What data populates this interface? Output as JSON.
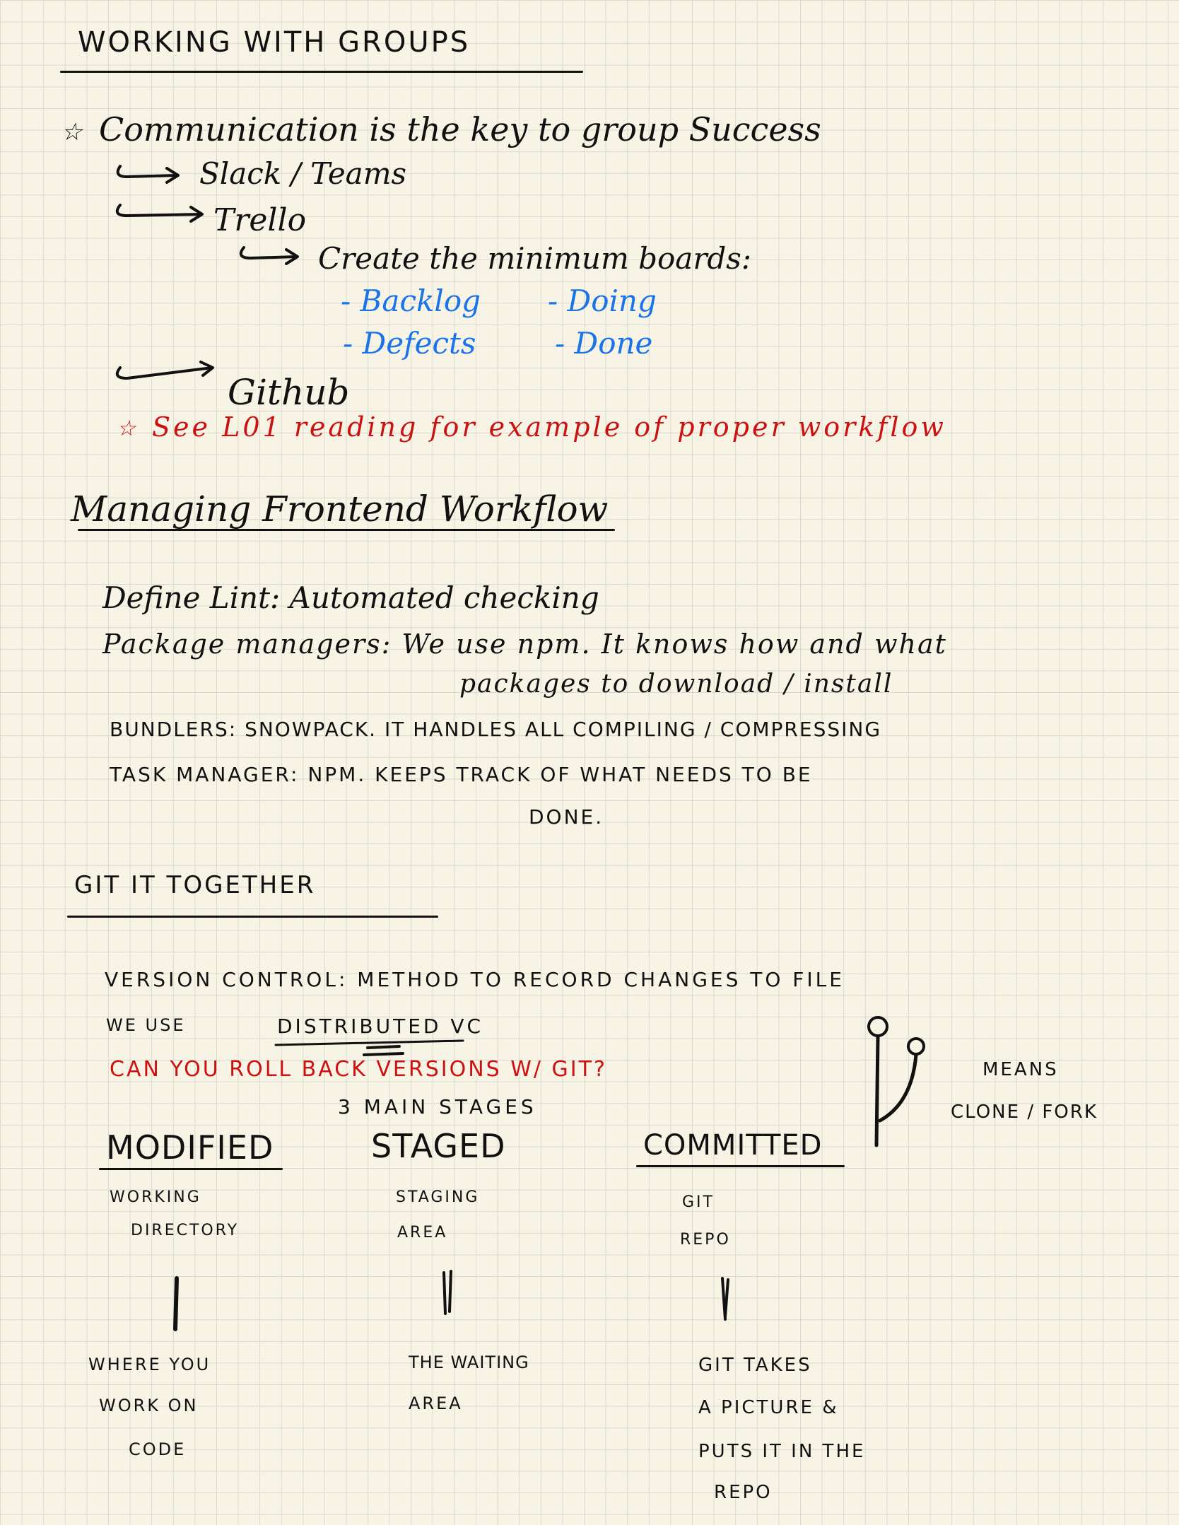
{
  "sections": {
    "groups": {
      "title": "WORKING WITH GROUPS",
      "bullet_star": "☆",
      "bullet": "Communication is the key to group Success",
      "items": [
        "Slack / Teams",
        "Trello",
        "Create the minimum boards:",
        "Github"
      ],
      "boards": [
        "- Backlog",
        "- Doing",
        "- Defects",
        "- Done"
      ],
      "note_star": "☆",
      "note": "See L01 reading for example of proper workflow"
    },
    "frontend": {
      "title": "Managing Frontend Workflow",
      "lint": "Define Lint: Automated checking",
      "pkg_line1": "Package managers: We use npm. It knows how and what",
      "pkg_line2": "packages to download / install",
      "bundlers": "BUNDLERS: SNOWPACK. IT HANDLES ALL COMPILING / COMPRESSING",
      "task_line1": "TASK MANAGER: NPM. KEEPS TRACK OF WHAT NEEDS TO BE",
      "task_line2": "DONE."
    },
    "git": {
      "title": "GIT IT TOGETHER",
      "version_control": "VERSION CONTROL: METHOD TO RECORD CHANGES TO FILE",
      "we_use_prefix": "WE USE",
      "we_use_value": "DISTRIBUTED VC",
      "question": "CAN YOU ROLL BACK VERSIONS W/ GIT?",
      "stages_intro": "3 MAIN STAGES",
      "means_label": "MEANS",
      "means_value": "CLONE / FORK",
      "stages": [
        {
          "name": "MODIFIED",
          "area_line1": "WORKING",
          "area_line2": "DIRECTORY",
          "desc": [
            "WHERE YOU",
            "WORK ON",
            "CODE"
          ]
        },
        {
          "name": "STAGED",
          "area_line1": "STAGING",
          "area_line2": "AREA",
          "desc": [
            "THE WAITING",
            "AREA"
          ]
        },
        {
          "name": "COMMITTED",
          "area_line1": "GIT",
          "area_line2": "REPO",
          "desc": [
            "GIT TAKES",
            "A PICTURE &",
            "PUTS IT IN THE",
            "REPO"
          ]
        }
      ]
    }
  },
  "colors": {
    "ink": "#111111",
    "blue": "#1a73e8",
    "red": "#cc1111",
    "paper": "#f7f4e6",
    "grid": "#d9d9cf"
  },
  "icons": {
    "arrow": "hooked-arrow-icon",
    "fork": "git-fork-icon"
  }
}
